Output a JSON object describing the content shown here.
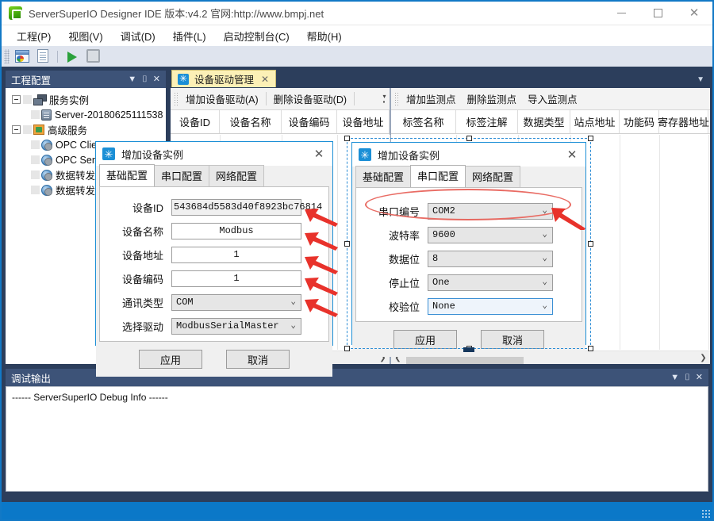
{
  "window": {
    "title": "ServerSuperIO Designer IDE 版本:v4.2 官网:http://www.bmpj.net",
    "minimize_label": "—",
    "maximize_label": "□",
    "close_label": "✕"
  },
  "menubar": {
    "items": [
      {
        "label": "工程(P)"
      },
      {
        "label": "视图(V)"
      },
      {
        "label": "调试(D)"
      },
      {
        "label": "插件(L)"
      },
      {
        "label": "启动控制台(C)"
      },
      {
        "label": "帮助(H)"
      }
    ]
  },
  "toolbar": {
    "buttons": [
      {
        "name": "project-icon"
      },
      {
        "name": "new-document-icon"
      },
      {
        "name": "run-icon"
      },
      {
        "name": "stop-icon"
      }
    ]
  },
  "project_panel": {
    "title": "工程配置",
    "dropdown_glyph": "▼",
    "pin_glyph": "⌷",
    "close_glyph": "✕",
    "tree": [
      {
        "label": "服务实例",
        "level": 1,
        "icon": "servers-icon",
        "expanded": true
      },
      {
        "label": "Server-20180625111538",
        "level": 2,
        "icon": "server-instance-icon"
      },
      {
        "label": "高级服务",
        "level": 1,
        "icon": "advanced-service-icon",
        "expanded": true
      },
      {
        "label": "OPC Client DA",
        "level": 2,
        "icon": "opc-icon"
      },
      {
        "label": "OPC Serv",
        "level": 2,
        "icon": "opc-icon"
      },
      {
        "label": "数据转发",
        "level": 2,
        "icon": "opc-icon"
      },
      {
        "label": "数据转发",
        "level": 2,
        "icon": "opc-icon"
      }
    ]
  },
  "document_tab": {
    "label": "设备驱动管理",
    "close_glyph": "✕",
    "overflow_glyph": "▼"
  },
  "device_pane": {
    "toolbar": [
      {
        "label": "增加设备驱动(A)"
      },
      {
        "label": "删除设备驱动(D)"
      }
    ],
    "columns": [
      "设备ID",
      "设备名称",
      "设备编码",
      "设备地址"
    ],
    "rows": []
  },
  "tag_pane": {
    "toolbar": [
      {
        "label": "增加监测点"
      },
      {
        "label": "删除监测点"
      },
      {
        "label": "导入监测点"
      }
    ],
    "columns": [
      "标签名称",
      "标签注解",
      "数据类型",
      "站点地址",
      "功能码",
      "寄存器地址"
    ],
    "rows": []
  },
  "debug_panel": {
    "title": "调试输出",
    "dropdown_glyph": "▼",
    "pin_glyph": "⌷",
    "close_glyph": "✕",
    "content": "------ ServerSuperIO Debug Info ------"
  },
  "dialog_basic": {
    "title": "增加设备实例",
    "close_glyph": "✕",
    "tabs": [
      {
        "label": "基础配置",
        "active": true
      },
      {
        "label": "串口配置",
        "active": false
      },
      {
        "label": "网络配置",
        "active": false
      }
    ],
    "fields": [
      {
        "label": "设备ID",
        "value": "543684d5583d40f8923bc76814",
        "type": "text-readonly"
      },
      {
        "label": "设备名称",
        "value": "Modbus",
        "type": "text"
      },
      {
        "label": "设备地址",
        "value": "1",
        "type": "text"
      },
      {
        "label": "设备编码",
        "value": "1",
        "type": "text"
      },
      {
        "label": "通讯类型",
        "value": "COM",
        "type": "select"
      },
      {
        "label": "选择驱动",
        "value": "ModbusSerialMaster",
        "type": "select"
      }
    ],
    "apply_label": "应用",
    "cancel_label": "取消"
  },
  "dialog_serial": {
    "title": "增加设备实例",
    "close_glyph": "✕",
    "tabs": [
      {
        "label": "基础配置",
        "active": false
      },
      {
        "label": "串口配置",
        "active": true
      },
      {
        "label": "网络配置",
        "active": false
      }
    ],
    "fields": [
      {
        "label": "串口编号",
        "value": "COM2",
        "type": "select",
        "focused": false
      },
      {
        "label": "波特率",
        "value": "9600",
        "type": "select",
        "focused": false
      },
      {
        "label": "数据位",
        "value": "8",
        "type": "select",
        "focused": false
      },
      {
        "label": "停止位",
        "value": "One",
        "type": "select",
        "focused": false
      },
      {
        "label": "校验位",
        "value": "None",
        "type": "select",
        "focused": true
      }
    ],
    "apply_label": "应用",
    "cancel_label": "取消"
  },
  "annotations": {
    "highlight_color": "#e8645c",
    "arrow_color": "#e8322b"
  },
  "colors": {
    "accent": "#0b78c8",
    "dock_header": "#3d5378",
    "workspace": "#2c3e5c",
    "tab_active": "#fcf0b6",
    "dialog_border": "#1c8fd6"
  }
}
